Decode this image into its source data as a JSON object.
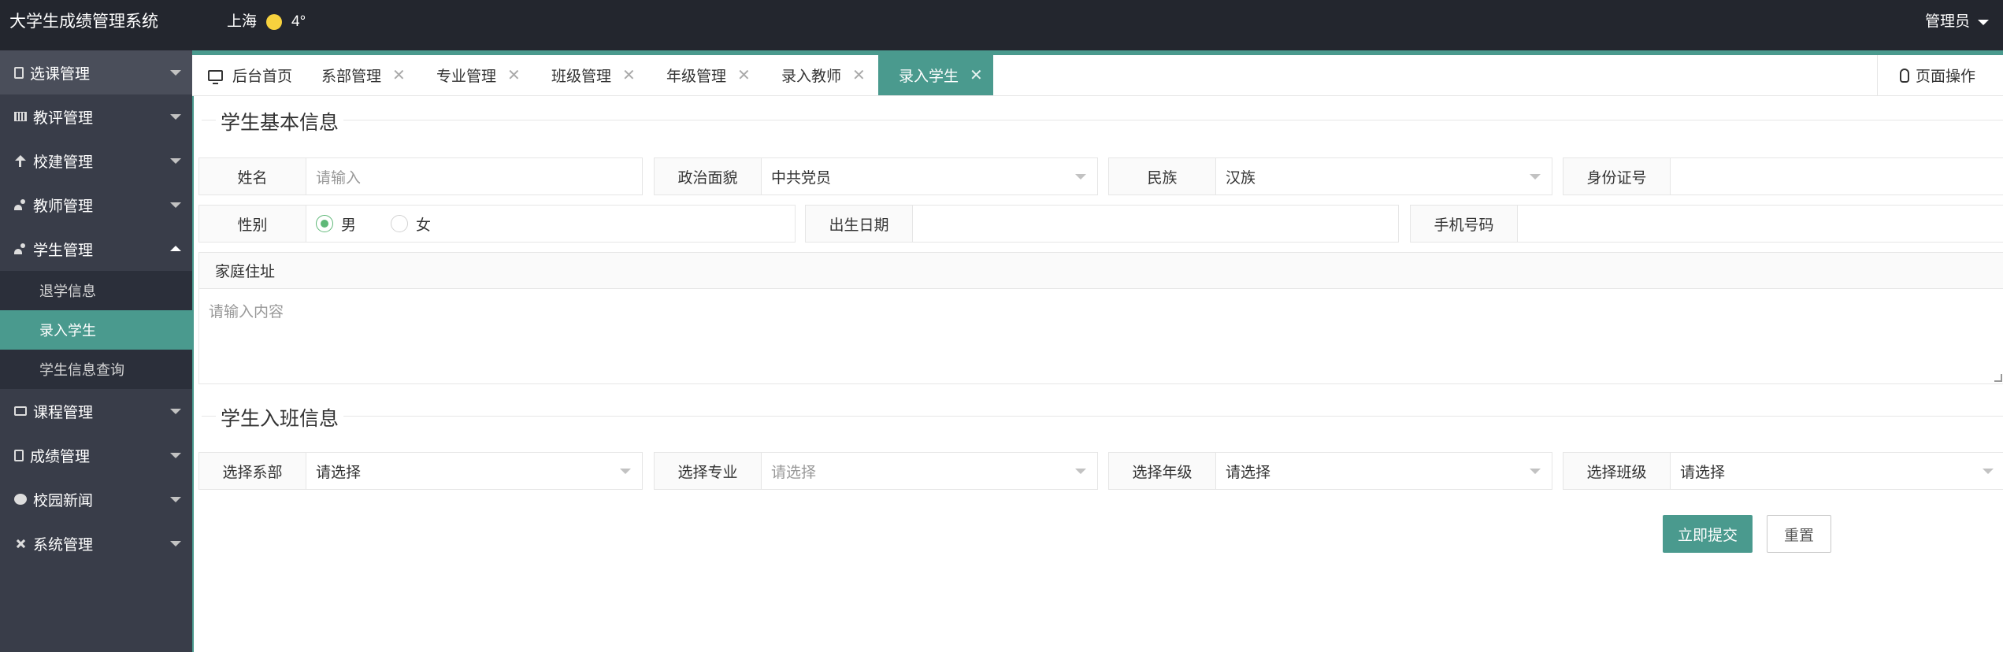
{
  "header": {
    "title": "大学生成绩管理系统",
    "city": "上海",
    "temperature": "4°",
    "user": "管理员"
  },
  "sidebar": {
    "items": [
      {
        "label": "选课管理",
        "icon": "document-icon"
      },
      {
        "label": "教评管理",
        "icon": "grid-icon"
      },
      {
        "label": "校建管理",
        "icon": "school-icon"
      },
      {
        "label": "教师管理",
        "icon": "users-icon"
      },
      {
        "label": "学生管理",
        "icon": "users-icon"
      },
      {
        "label": "课程管理",
        "icon": "book-icon"
      },
      {
        "label": "成绩管理",
        "icon": "document-icon"
      },
      {
        "label": "校园新闻",
        "icon": "chat-icon"
      },
      {
        "label": "系统管理",
        "icon": "tools-icon"
      }
    ],
    "student_sub": [
      "退学信息",
      "录入学生",
      "学生信息查询"
    ]
  },
  "tabs": {
    "home": "后台首页",
    "items": [
      "系部管理",
      "专业管理",
      "班级管理",
      "年级管理",
      "录入教师",
      "录入学生"
    ],
    "close": "✕",
    "page_op": "页面操作"
  },
  "form": {
    "section1": "学生基本信息",
    "name_label": "姓名",
    "name_placeholder": "请输入",
    "politics_label": "政治面貌",
    "politics_value": "中共党员",
    "ethnic_label": "民族",
    "ethnic_value": "汉族",
    "id_label": "身份证号",
    "gender_label": "性别",
    "gender_male": "男",
    "gender_female": "女",
    "birth_label": "出生日期",
    "phone_label": "手机号码",
    "address_label": "家庭住址",
    "address_placeholder": "请输入内容",
    "section2": "学生入班信息",
    "dept_label": "选择系部",
    "dept_value": "请选择",
    "major_label": "选择专业",
    "major_value": "请选择",
    "grade_label": "选择年级",
    "grade_value": "请选择",
    "class_label": "选择班级",
    "class_value": "请选择",
    "submit": "立即提交",
    "reset": "重置"
  },
  "colors": {
    "header_bg": "#23262e",
    "sidebar_bg": "#393d49",
    "accent": "#4a9a8e",
    "radio_on": "#5fb878"
  }
}
